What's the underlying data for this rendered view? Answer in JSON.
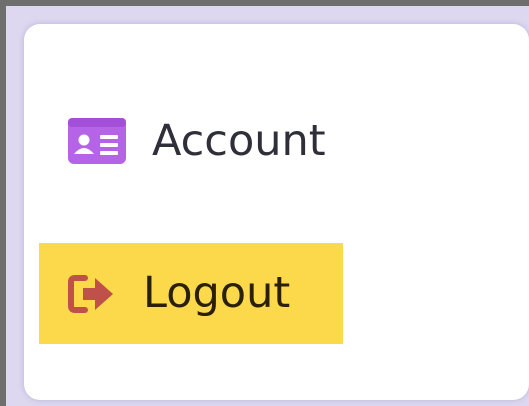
{
  "menu": {
    "items": [
      {
        "label": "Account",
        "icon": "id-card-icon",
        "active": false
      },
      {
        "label": "Logout",
        "icon": "sign-out-icon",
        "active": true
      }
    ]
  },
  "colors": {
    "account_icon": "#b564e8",
    "logout_icon": "#c0504a",
    "active_highlight": "#fbd94a",
    "card_background": "#ffffff",
    "backdrop": "#ddd8f0"
  }
}
